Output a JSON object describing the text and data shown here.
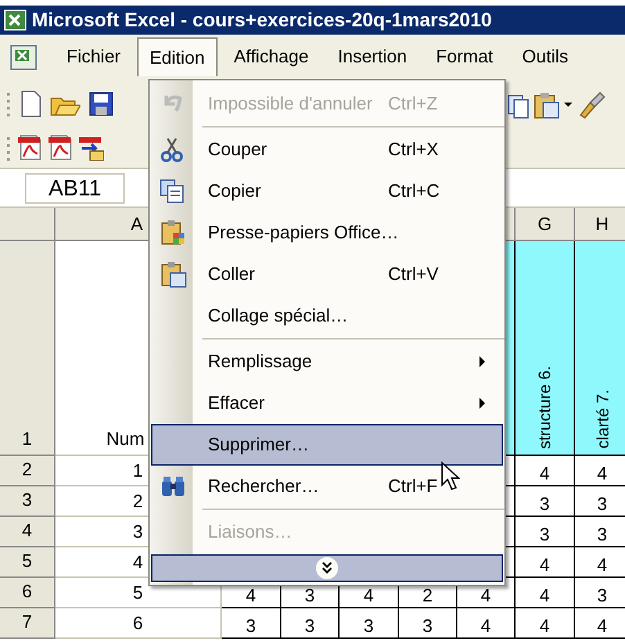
{
  "window": {
    "title": "Microsoft Excel - cours+exercices-20q-1mars2010"
  },
  "menu_bar": [
    {
      "label": "Fichier",
      "selected": false
    },
    {
      "label": "Edition",
      "selected": true
    },
    {
      "label": "Affichage",
      "selected": false
    },
    {
      "label": "Insertion",
      "selected": false
    },
    {
      "label": "Format",
      "selected": false
    },
    {
      "label": "Outils",
      "selected": false
    }
  ],
  "name_box": {
    "value": "AB11"
  },
  "columns": [
    {
      "label": "A"
    },
    {},
    {},
    {},
    {},
    {},
    {
      "label": "G"
    },
    {
      "label": "H"
    }
  ],
  "rows": [
    {
      "number": "1",
      "kind": "heading",
      "cells": [
        "Num",
        null,
        null,
        null,
        null,
        null,
        "structure 6.",
        "clarté 7."
      ]
    },
    {
      "number": "2",
      "kind": "data",
      "cells": [
        "1",
        null,
        null,
        null,
        null,
        null,
        "4",
        "4"
      ]
    },
    {
      "number": "3",
      "kind": "data",
      "cells": [
        "2",
        null,
        null,
        null,
        null,
        null,
        "3",
        "3"
      ]
    },
    {
      "number": "4",
      "kind": "data",
      "cells": [
        "3",
        null,
        null,
        null,
        null,
        null,
        "3",
        "3"
      ]
    },
    {
      "number": "5",
      "kind": "data",
      "cells": [
        "4",
        null,
        null,
        null,
        null,
        null,
        "4",
        "4"
      ]
    },
    {
      "number": "6",
      "kind": "data",
      "cells": [
        "5",
        "4",
        "3",
        "4",
        "2",
        "4",
        "4",
        "3"
      ]
    },
    {
      "number": "7",
      "kind": "data",
      "cells": [
        "6",
        "3",
        "3",
        "3",
        "3",
        "4",
        "4",
        "4"
      ]
    }
  ],
  "edit_menu": [
    {
      "kind": "item",
      "label": "Impossible d'annuler",
      "shortcut": "Ctrl+Z",
      "disabled": true,
      "selected": false,
      "submenu": false
    },
    {
      "kind": "separator"
    },
    {
      "kind": "item",
      "label": "Couper",
      "shortcut": "Ctrl+X",
      "disabled": false,
      "selected": false,
      "submenu": false
    },
    {
      "kind": "item",
      "label": "Copier",
      "shortcut": "Ctrl+C",
      "disabled": false,
      "selected": false,
      "submenu": false
    },
    {
      "kind": "item",
      "label": "Presse-papiers Office…",
      "disabled": false,
      "selected": false,
      "submenu": false
    },
    {
      "kind": "item",
      "label": "Coller",
      "shortcut": "Ctrl+V",
      "disabled": false,
      "selected": false,
      "submenu": false
    },
    {
      "kind": "item",
      "label": "Collage spécial…",
      "disabled": false,
      "selected": false,
      "submenu": false
    },
    {
      "kind": "separator"
    },
    {
      "kind": "item",
      "label": "Remplissage",
      "disabled": false,
      "selected": false,
      "submenu": true
    },
    {
      "kind": "item",
      "label": "Effacer",
      "disabled": false,
      "selected": false,
      "submenu": true
    },
    {
      "kind": "item",
      "label": "Supprimer…",
      "disabled": false,
      "selected": true,
      "submenu": false
    },
    {
      "kind": "item",
      "label": "Rechercher…",
      "shortcut": "Ctrl+F",
      "disabled": false,
      "selected": false,
      "submenu": false
    },
    {
      "kind": "separator"
    },
    {
      "kind": "item",
      "label": "Liaisons…",
      "disabled": true,
      "selected": false,
      "submenu": false
    },
    {
      "kind": "expand",
      "selected": true
    }
  ]
}
